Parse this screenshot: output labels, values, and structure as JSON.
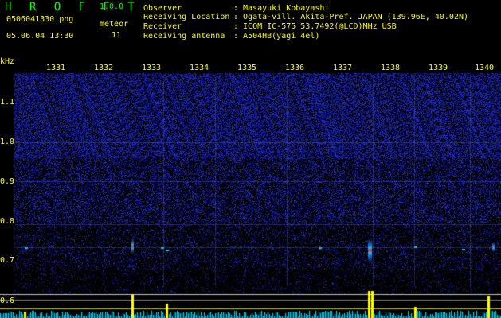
{
  "app": {
    "title": "H R O F F T",
    "version": "1.0.0"
  },
  "file": {
    "name": "0506041330.png",
    "datetime": "05.06.04 13:30"
  },
  "meteor": {
    "label": "meteor",
    "count": "11"
  },
  "info": [
    {
      "key": "Observer",
      "value": ": Masayuki Kobayashi"
    },
    {
      "key": "Receiving Location",
      "value": ": Ogata-vill. Akita-Pref. JAPAN (139.96E, 40.02N)"
    },
    {
      "key": "Receiver",
      "value": ": ICOM IC-575 53.7492(@LCD)MHz USB"
    },
    {
      "key": "Receiving antenna",
      "value": ": A504HB(yagi 4el)"
    }
  ],
  "axis": {
    "y_unit": "kHz",
    "y_ticks": [
      "1.1",
      "1.0",
      "0.9",
      "0.8",
      "0.7",
      "0.6"
    ],
    "x_ticks": [
      "1331",
      "1332",
      "1333",
      "1334",
      "1335",
      "1336",
      "1337",
      "1338",
      "1339",
      "1340"
    ]
  },
  "colors": {
    "accent_green": "#00ff00",
    "label_yellow": "#ffff00",
    "noise_blue": "#2a3cff",
    "signal_red": "#ff2040",
    "trace_cyan": "#00e0ff"
  }
}
